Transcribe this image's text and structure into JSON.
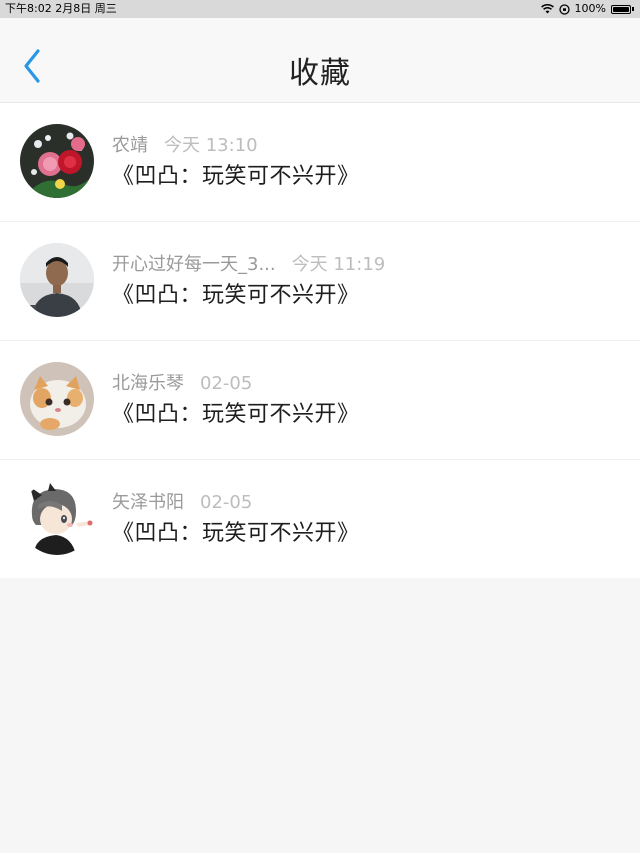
{
  "status_bar": {
    "time_date": "下午8:02   2月8日 周三",
    "battery": "100%"
  },
  "nav": {
    "title": "收藏"
  },
  "items": [
    {
      "user": "农靖",
      "time": "今天 13:10",
      "title": "《凹凸：玩笑可不兴开》",
      "avatar": "roses-avatar"
    },
    {
      "user": "开心过好每一天_3...",
      "time": "今天 11:19",
      "title": "《凹凸：玩笑可不兴开》",
      "avatar": "man-avatar"
    },
    {
      "user": "北海乐琴",
      "time": "02-05",
      "title": "《凹凸：玩笑可不兴开》",
      "avatar": "cat-avatar"
    },
    {
      "user": "矢泽书阳",
      "time": "02-05",
      "title": "《凹凸：玩笑可不兴开》",
      "avatar": "anime-avatar"
    }
  ],
  "colors": {
    "accent": "#2a97e6",
    "background": "#f7f6f7"
  }
}
